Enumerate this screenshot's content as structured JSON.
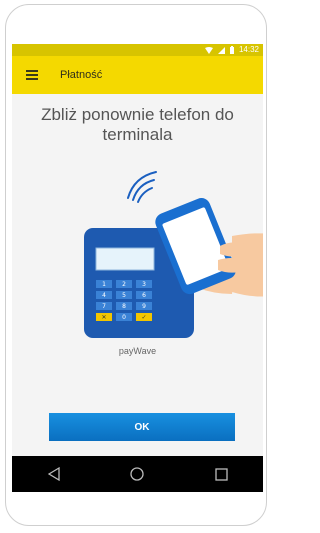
{
  "status": {
    "time": "14:32"
  },
  "appbar": {
    "title": "Płatność",
    "menu_icon": "hamburger-menu-icon"
  },
  "main": {
    "heading_line1": "Zbliż ponownie telefon do",
    "heading_line2": "terminala",
    "payment_method": "payWave",
    "ok_label": "OK"
  },
  "keypad": {
    "keys": [
      "1",
      "2",
      "3",
      "4",
      "5",
      "6",
      "7",
      "8",
      "9",
      "✕",
      "0",
      "✓"
    ]
  },
  "navbar": {
    "icons": [
      "back-icon",
      "home-icon",
      "recents-icon"
    ]
  },
  "colors": {
    "status_bar": "#d7c400",
    "app_bar": "#f4d900",
    "button": "#0a7fd0",
    "terminal": "#1e5ab0"
  }
}
